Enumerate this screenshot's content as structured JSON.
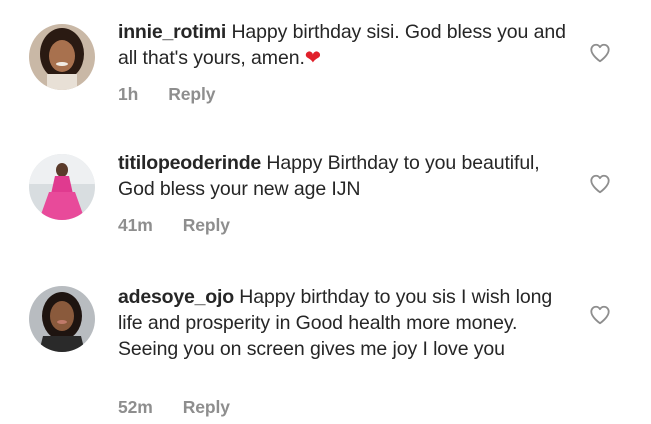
{
  "comments": [
    {
      "username": "innie_rotimi",
      "text": "Happy birthday sisi. God bless you and all that's yours, amen.",
      "emoji": "❤",
      "time": "1h",
      "reply_label": "Reply"
    },
    {
      "username": "titilopeoderinde",
      "text": "Happy Birthday to you beautiful, God bless your new age IJN",
      "emoji": "",
      "time": "41m",
      "reply_label": "Reply"
    },
    {
      "username": "adesoye_ojo",
      "text": "Happy birthday to  you sis I wish long life and prosperity in Good health more money. Seeing you on screen gives me joy I love you",
      "emoji": "",
      "time": "52m",
      "reply_label": "Reply"
    }
  ],
  "icons": {
    "like": "heart-outline-icon",
    "avatar": "user-avatar"
  },
  "colors": {
    "text": "#262626",
    "meta": "#8e8e8e",
    "heart_outline": "#8e8e8e",
    "emoji_heart": "#e0202a"
  }
}
